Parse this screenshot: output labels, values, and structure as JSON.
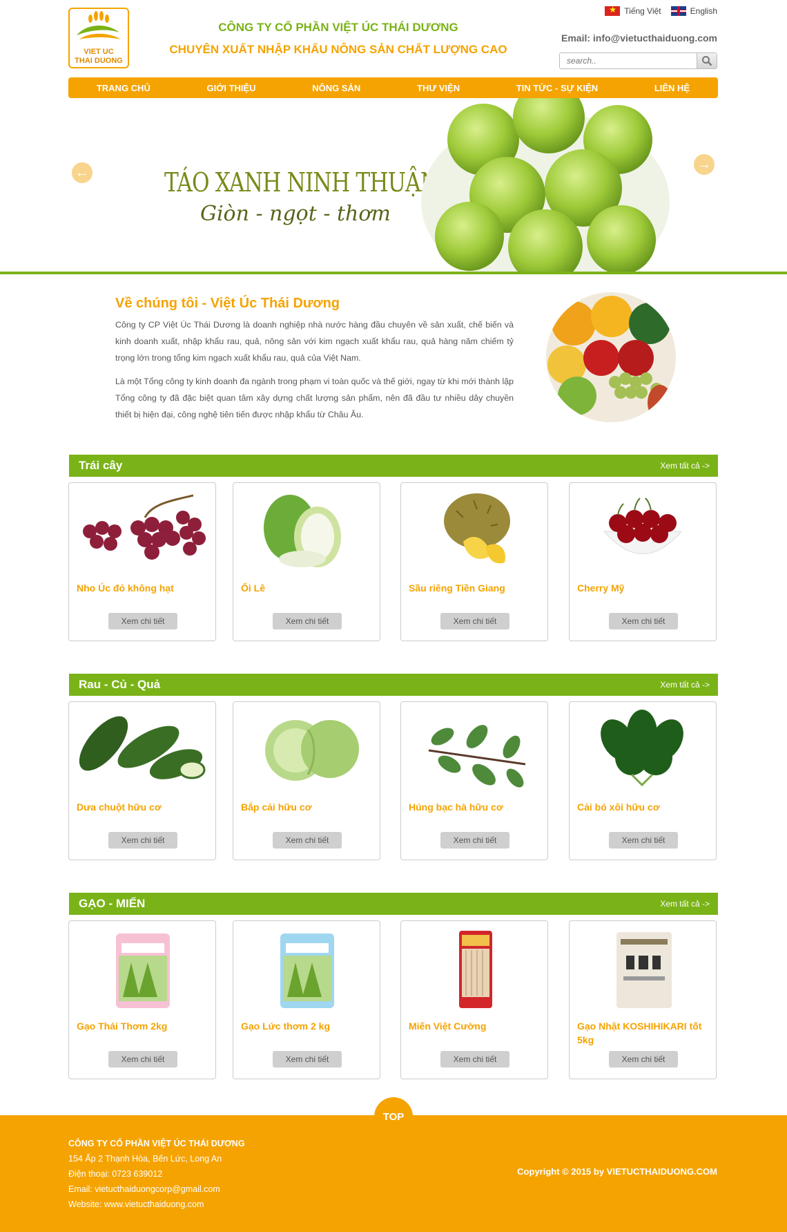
{
  "header": {
    "logo_line1": "VIET UC",
    "logo_line2": "THAI DUONG",
    "company_name": "CÔNG TY CỔ PHẦN VIỆT ÚC THÁI DƯƠNG",
    "slogan": "CHUYÊN XUẤT NHẬP KHẨU NÔNG SẢN CHẤT LƯỢNG CAO",
    "lang_vi": "Tiếng Việt",
    "lang_en": "English",
    "email": "Email: info@vietucthaiduong.com",
    "search_placeholder": "search.."
  },
  "nav": [
    "TRANG CHỦ",
    "GIỚI THIỆU",
    "NÔNG SẢN",
    "THƯ VIỆN",
    "TIN TỨC - SỰ KIỆN",
    "LIÊN HỆ"
  ],
  "banner": {
    "title": "TÁO XANH NINH THUẬN",
    "subtitle": "Giòn - ngọt - thơm"
  },
  "about": {
    "title": "Về chúng tôi - Việt Úc Thái Dương",
    "p1": "Công ty CP Việt Úc Thái Dương là doanh nghiệp nhà nước hàng đầu chuyên về sản xuất, chế biến và kinh doanh xuất, nhập khẩu rau, quả, nông sản với kim ngạch xuất khẩu rau, quả hàng năm chiếm tỷ trọng lớn trong tổng kim ngạch xuất khẩu rau, quả của Việt Nam.",
    "p2": "Là một Tổng công ty kinh doanh đa ngành trong phạm vi toàn quốc và thế giới, ngay từ khi mới thành lập Tổng công ty đã đặc biệt quan tâm xây dựng chất lượng sản phẩm, nên đã đầu tư nhiều dây chuyền thiết bị hiện đại, công nghệ tiên tiến được nhập khẩu từ Châu Âu."
  },
  "sections": [
    {
      "title": "Trái cây",
      "more": "Xem tất cả ->",
      "products": [
        {
          "name": "Nho Úc đỏ không hạt",
          "button": "Xem chi tiết"
        },
        {
          "name": "Ổi Lê",
          "button": "Xem chi tiết"
        },
        {
          "name": "Sầu riêng Tiền Giang",
          "button": "Xem chi tiết"
        },
        {
          "name": "Cherry Mỹ",
          "button": "Xem chi tiết"
        }
      ]
    },
    {
      "title": "Rau - Củ - Quả",
      "more": "Xem tất cả ->",
      "products": [
        {
          "name": "Dưa chuột hữu cơ",
          "button": "Xem chi tiết"
        },
        {
          "name": "Bắp cải hữu cơ",
          "button": "Xem chi tiết"
        },
        {
          "name": "Húng bạc hà hữu cơ",
          "button": "Xem chi tiết"
        },
        {
          "name": "Cải bó xôi hữu cơ",
          "button": "Xem chi tiết"
        }
      ]
    },
    {
      "title": "GẠO - MIẾN",
      "more": "Xem tất cả ->",
      "products": [
        {
          "name": "Gạo Thái Thơm 2kg",
          "button": "Xem chi tiết"
        },
        {
          "name": "Gạo Lức thơm 2 kg",
          "button": "Xem chi tiết"
        },
        {
          "name": "Miến Việt Cường",
          "button": "Xem chi tiết"
        },
        {
          "name": "Gạo Nhật KOSHIHIKARI tốt 5kg",
          "button": "Xem chi tiết"
        }
      ]
    }
  ],
  "footer": {
    "top_label": "TOP",
    "company": "CÔNG TY CỔ PHẦN VIỆT ÚC THÁI DƯƠNG",
    "address": "154 Ấp 2 Thạnh Hòa, Bến Lức, Long An",
    "phone": "Điện thoại: 0723 639012",
    "email": "Email: vietucthaiduongcorp@gmail.com",
    "website": "Website: www.vietucthaiduong.com",
    "copyright": "Copyright © 2015 by VIETUCTHAIDUONG.COM"
  },
  "colors": {
    "accent": "#f5a300",
    "green": "#7ab317"
  }
}
